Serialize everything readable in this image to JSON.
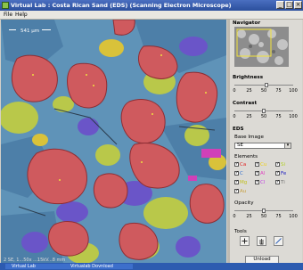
{
  "window": {
    "title": "Virtual Lab : Costa Rican Sand (EDS) (Scanning Electron Microscope)",
    "minimize": "_",
    "maximize": "□",
    "close": "×"
  },
  "menu": {
    "file": "File",
    "help": "Help"
  },
  "viewer": {
    "scale_label": "541 μm"
  },
  "panel": {
    "navigator": "Navigator",
    "brightness": {
      "label": "Brightness",
      "value_percent": 54
    },
    "contrast": {
      "label": "Contrast",
      "value_percent": 50
    },
    "eds": "EDS",
    "base_image_label": "Base Image",
    "base_image_value": "SE",
    "elements_label": "Elements",
    "elements": [
      {
        "symbol": "Ca",
        "color": "#e02020",
        "checked": true
      },
      {
        "symbol": "Cu",
        "color": "#f0d010",
        "checked": true
      },
      {
        "symbol": "Si",
        "color": "#b0d020",
        "checked": true
      },
      {
        "symbol": "C",
        "color": "#2f6fd0",
        "checked": true
      },
      {
        "symbol": "Al",
        "color": "#e040c0",
        "checked": true
      },
      {
        "symbol": "Fe",
        "color": "#2020c0",
        "checked": true
      },
      {
        "symbol": "Mg",
        "color": "#c0c020",
        "checked": true
      },
      {
        "symbol": "Cl",
        "color": "#c040e0",
        "checked": true
      },
      {
        "symbol": "Ti",
        "color": "#707070",
        "checked": true
      },
      {
        "symbol": "Au",
        "color": "#c8a040",
        "checked": true
      }
    ],
    "opacity": {
      "label": "Opacity",
      "value_percent": 50
    },
    "ticks": [
      "0",
      "25",
      "50",
      "75",
      "100"
    ],
    "tools_label": "Tools",
    "tools": [
      "add-icon",
      "hand-icon",
      "measure-icon"
    ],
    "unload": "Unload"
  },
  "taskbar": {
    "status": "2 SE, 1...50x ...15kV...8 mm",
    "item1": "Virtual Lab",
    "item2": "Virtualab Dovnload"
  }
}
